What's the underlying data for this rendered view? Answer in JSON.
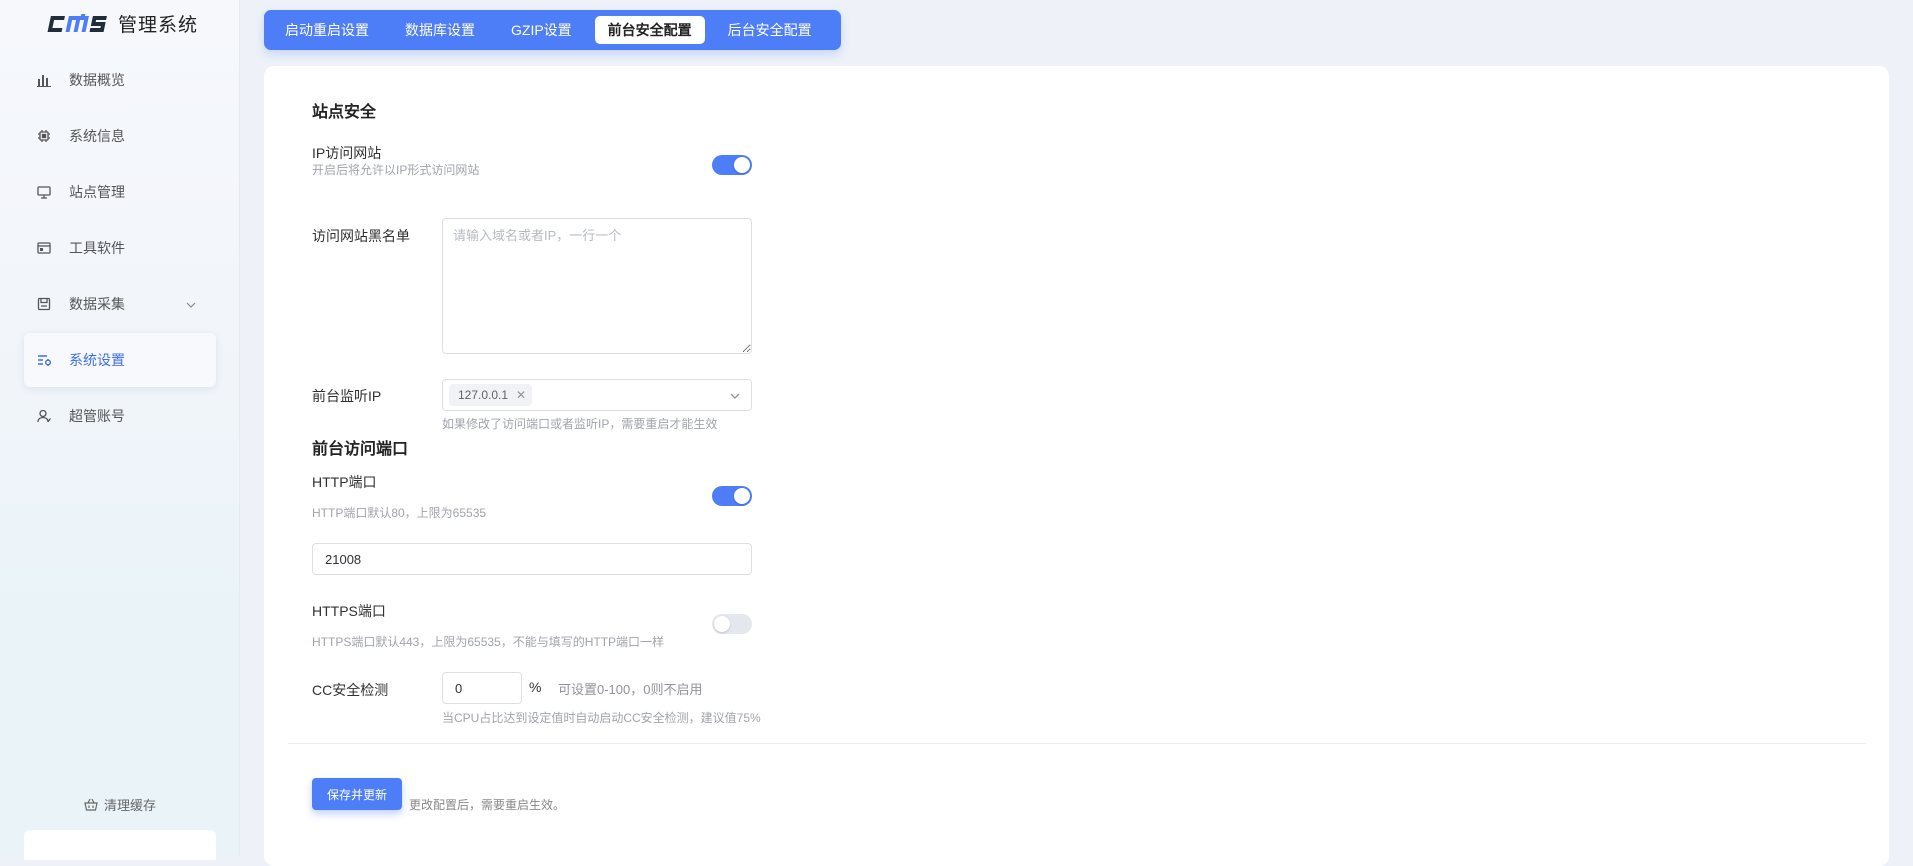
{
  "app": {
    "logo_text": "cms",
    "title": "管理系统"
  },
  "sidebar": {
    "items": [
      {
        "label": "数据概览",
        "icon": "bar-chart-icon"
      },
      {
        "label": "系统信息",
        "icon": "cpu-chip-icon"
      },
      {
        "label": "站点管理",
        "icon": "monitor-icon"
      },
      {
        "label": "工具软件",
        "icon": "window-icon"
      },
      {
        "label": "数据采集",
        "icon": "save-disk-icon",
        "has_submenu": true
      },
      {
        "label": "系统设置",
        "icon": "settings-list-icon",
        "active": true
      },
      {
        "label": "超管账号",
        "icon": "user-icon"
      }
    ],
    "clear_cache_label": "清理缓存"
  },
  "tabs": [
    {
      "label": "启动重启设置"
    },
    {
      "label": "数据库设置"
    },
    {
      "label": "GZIP设置"
    },
    {
      "label": "前台安全配置",
      "active": true
    },
    {
      "label": "后台安全配置"
    }
  ],
  "form": {
    "site_security_title": "站点安全",
    "ip_access": {
      "label": "IP访问网站",
      "hint": "开启后将允许以IP形式访问网站",
      "enabled": true
    },
    "blacklist": {
      "label": "访问网站黑名单",
      "placeholder": "请输入域名或者IP，一行一个",
      "value": ""
    },
    "listen_ip": {
      "label": "前台监听IP",
      "tag": "127.0.0.1",
      "hint": "如果修改了访问端口或者监听IP，需要重启才能生效"
    },
    "port_title": "前台访问端口",
    "http": {
      "label": "HTTP端口",
      "hint": "HTTP端口默认80，上限为65535",
      "enabled": true,
      "value": "21008"
    },
    "https": {
      "label": "HTTPS端口",
      "hint": "HTTPS端口默认443，上限为65535，不能与填写的HTTP端口一样",
      "enabled": false
    },
    "cc": {
      "label": "CC安全检测",
      "value": "0",
      "unit": "%",
      "range_note": "可设置0-100，0则不启用",
      "hint": "当CPU占比达到设定值时自动启动CC安全检测，建议值75%"
    },
    "save_button": "保存并更新",
    "save_note": "更改配置后，需要重启生效。"
  },
  "colors": {
    "accent": "#4d7ef7",
    "active_text": "#3d6ef0"
  }
}
